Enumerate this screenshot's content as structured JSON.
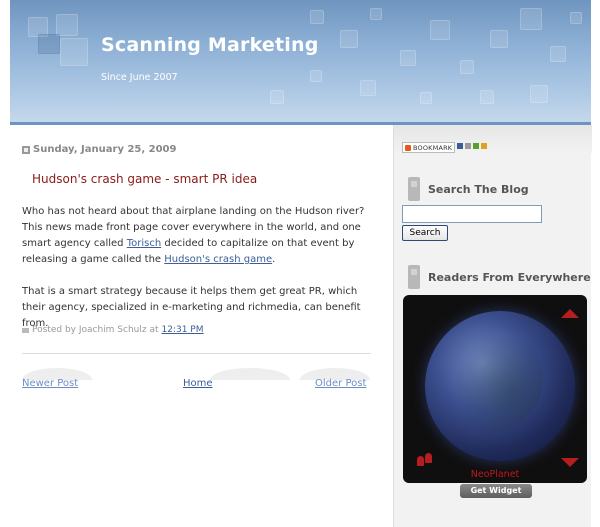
{
  "header": {
    "title": "Scanning Marketing",
    "description": "Since June 2007"
  },
  "post": {
    "date": "Sunday, January 25, 2009",
    "title": "Hudson's crash game - smart PR idea",
    "para1_part1": "Who has not heard about that airplane landing on the Hudson river? This news made front page cover everywhere in the world, and one smart agency called ",
    "para1_link1": "Torisch",
    "para1_part2": " decided to capitalize on that event by releasing a game called the ",
    "para1_link2": "Hudson's crash game",
    "para1_part3": ".",
    "para2": "That is a smart strategy because it helps them get great PR, which their agency, specialized in e-marketing and richmedia, can benefit from.",
    "footer_prefix": "Posted by Joachim Schulz at",
    "footer_time": "12:31 PM"
  },
  "nav": {
    "newer": "Newer Post",
    "home": "Home",
    "older": "Older Post"
  },
  "sidebar": {
    "bookmark_label": "BOOKMARK",
    "search_heading": "Search The Blog",
    "search_placeholder": "",
    "search_value": "",
    "search_button": "Search",
    "readers_heading": "Readers From Everywhere",
    "widget_brand": "NeoPlanet",
    "get_widget": "Get Widget"
  },
  "colors": {
    "post_title": "#8b1a1a",
    "link": "#3b5d9a",
    "header_blue": "#8cafd4",
    "widget_red": "#b51e1e"
  }
}
